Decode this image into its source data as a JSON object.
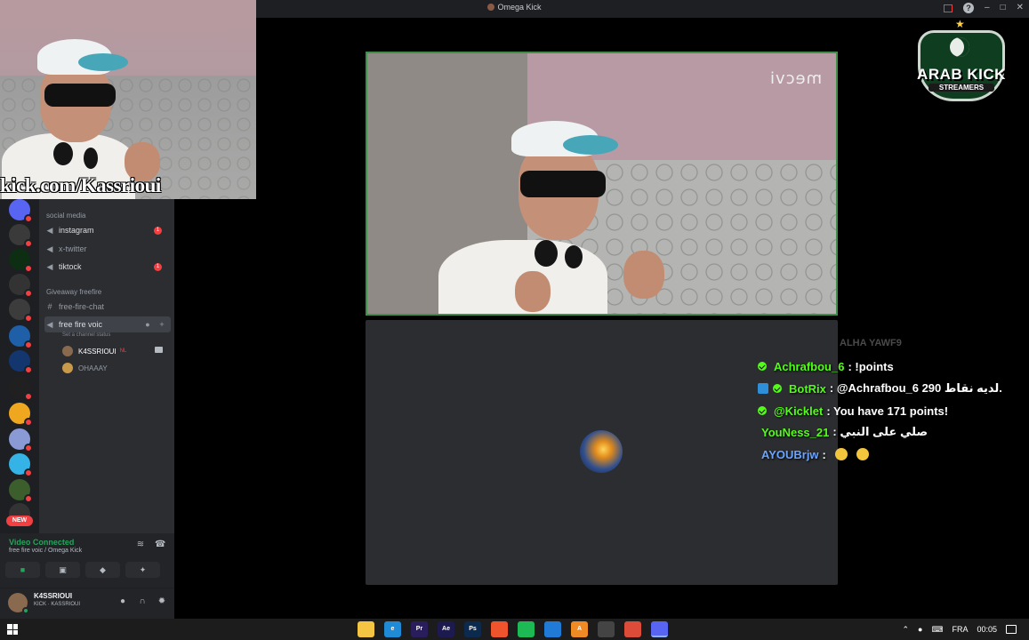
{
  "window": {
    "title": "Omega Kick",
    "controls": [
      "–",
      "□",
      "✕"
    ]
  },
  "overlay": {
    "url_text": "kick.com/Kassrioui",
    "watermark": "mecvi"
  },
  "logo": {
    "line1": "ARAB KICK",
    "line2": "STREAMERS"
  },
  "sidebar": {
    "category_social": "social media",
    "channels_social": [
      {
        "label": "instagram",
        "ping": "1"
      },
      {
        "label": "x-twitter",
        "ping": ""
      },
      {
        "label": "tiktock",
        "ping": "1"
      }
    ],
    "category_giveaway": "Giveaway freefire",
    "text_channel": "free-fire-chat",
    "voice_channel": "free fire voic",
    "voice_status_hint": "Set a channel status",
    "voice_users": [
      {
        "name": "K4SSRIOUI",
        "tag": "NL"
      },
      {
        "name": "OHAAAY",
        "tag": ""
      }
    ],
    "new_badge": "NEW"
  },
  "voice_panel": {
    "status": "Video Connected",
    "location": "free fire voic / Omega Kick"
  },
  "user_panel": {
    "username": "K4SSRIOUI",
    "status": "KICK · KASSRIOUI"
  },
  "chat": {
    "faded_line": "ALHA YAWF9",
    "messages": [
      {
        "user": "Achrafbou_6",
        "text": ": !points",
        "user_color": "#53fc18",
        "verified": true,
        "bot": false
      },
      {
        "user": "BotRix",
        "text": ": @Achrafbou_6 290 لديه نقاط.",
        "user_color": "#53fc18",
        "verified": true,
        "bot": true
      },
      {
        "user": "@Kicklet",
        "text": ": You have 171 points!",
        "user_color": "#53fc18",
        "verified": true,
        "bot": false
      },
      {
        "user": "YouNess_21",
        "text": ": صلي على النبي",
        "user_color": "#53fc18",
        "verified": false,
        "bot": false
      },
      {
        "user": "AYOUBrjw",
        "text": ":",
        "user_color": "#6aa4ff",
        "verified": false,
        "bot": false
      }
    ]
  },
  "taskbar": {
    "language": "FRA",
    "time": "00:05",
    "apps": [
      {
        "name": "file-explorer-icon",
        "label": "",
        "color": "#f4c542"
      },
      {
        "name": "edge-icon",
        "label": "e",
        "color": "#1f8ad6"
      },
      {
        "name": "premiere-icon",
        "label": "Pr",
        "color": "#2a1d5c"
      },
      {
        "name": "after-effects-icon",
        "label": "Ae",
        "color": "#1c1a4e"
      },
      {
        "name": "photoshop-icon",
        "label": "Ps",
        "color": "#0c2a4e"
      },
      {
        "name": "brave-icon",
        "label": "",
        "color": "#f0542d"
      },
      {
        "name": "spotify-icon",
        "label": "",
        "color": "#1db954"
      },
      {
        "name": "vscode-icon",
        "label": "",
        "color": "#1f7bd6"
      },
      {
        "name": "illustrator-icon",
        "label": "A",
        "color": "#f08a24"
      },
      {
        "name": "obs-icon",
        "label": "",
        "color": "#444444"
      },
      {
        "name": "chrome-icon",
        "label": "",
        "color": "#dd4b39"
      },
      {
        "name": "discord-icon",
        "label": "",
        "color": "#5865f2"
      }
    ]
  }
}
